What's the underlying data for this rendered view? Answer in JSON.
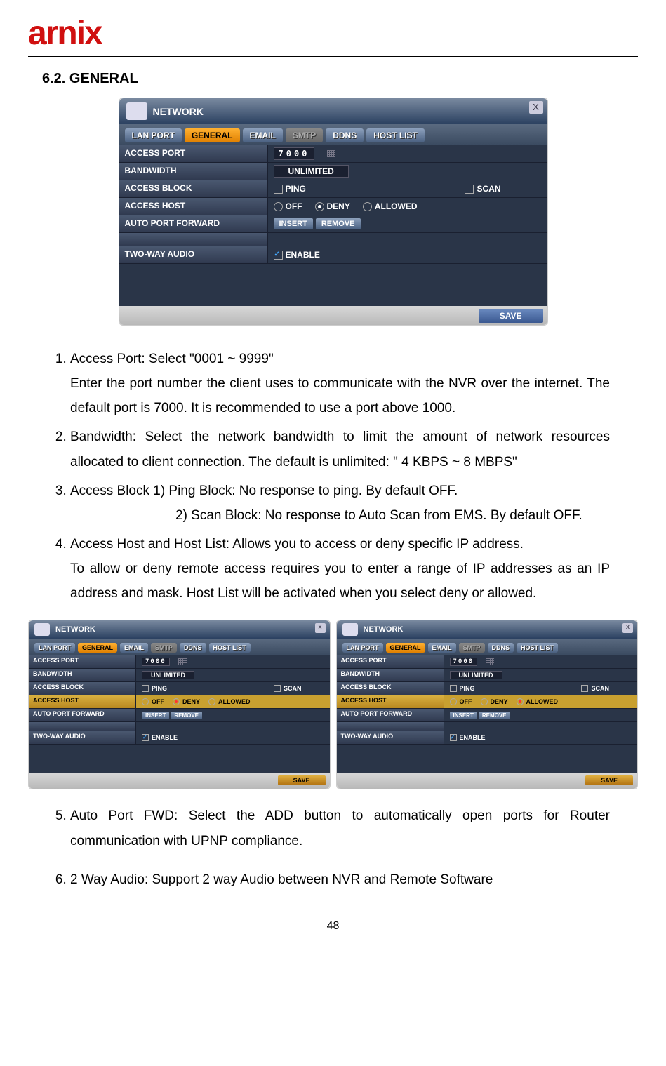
{
  "logo": "arnix",
  "section_title": "6.2.  GENERAL",
  "panel": {
    "title": "NETWORK",
    "close": "X",
    "tabs": {
      "lan": "LAN PORT",
      "general": "GENERAL",
      "email": "EMAIL",
      "smtp": "SMTP",
      "ddns": "DDNS",
      "host": "HOST LIST"
    },
    "rows": {
      "access_port": {
        "label": "ACCESS PORT",
        "value": "7000"
      },
      "bandwidth": {
        "label": "BANDWIDTH",
        "value": "UNLIMITED"
      },
      "access_block": {
        "label": "ACCESS BLOCK",
        "ping": "PING",
        "scan": "SCAN"
      },
      "access_host": {
        "label": "ACCESS HOST",
        "off": "OFF",
        "deny": "DENY",
        "allowed": "ALLOWED"
      },
      "auto_port": {
        "label": "AUTO PORT FORWARD",
        "insert": "INSERT",
        "remove": "REMOVE"
      },
      "two_way": {
        "label": "TWO-WAY AUDIO",
        "enable": "ENABLE"
      }
    },
    "save": "SAVE"
  },
  "list": {
    "item1_a": "Access Port: Select \"0001 ~ 9999\"",
    "item1_b": "Enter the port number the client uses to communicate with the NVR over the internet. The default port is 7000. It is recommended to use a port above 1000.",
    "item2": "Bandwidth: Select the network bandwidth to limit the amount of network resources allocated to client connection. The default is unlimited: \" 4 KBPS ~ 8 MBPS\"",
    "item3_a": "Access Block    1) Ping Block: No response to ping. By default OFF.",
    "item3_b": "2) Scan Block: No response to Auto Scan from EMS. By default OFF.",
    "item4_a": "Access Host and Host List: Allows you to access or deny specific IP address.",
    "item4_b": "To allow or deny remote access requires you to enter a range of IP addresses as an IP address and mask.    Host List will be activated when you select deny or allowed.",
    "item5": "Auto  Port  FWD:  Select  the  ADD  button  to  automatically  open  ports  for  Router communication with UPNP compliance.",
    "item6": "2 Way Audio: Support 2 way Audio between NVR and Remote Software"
  },
  "page_number": "48"
}
